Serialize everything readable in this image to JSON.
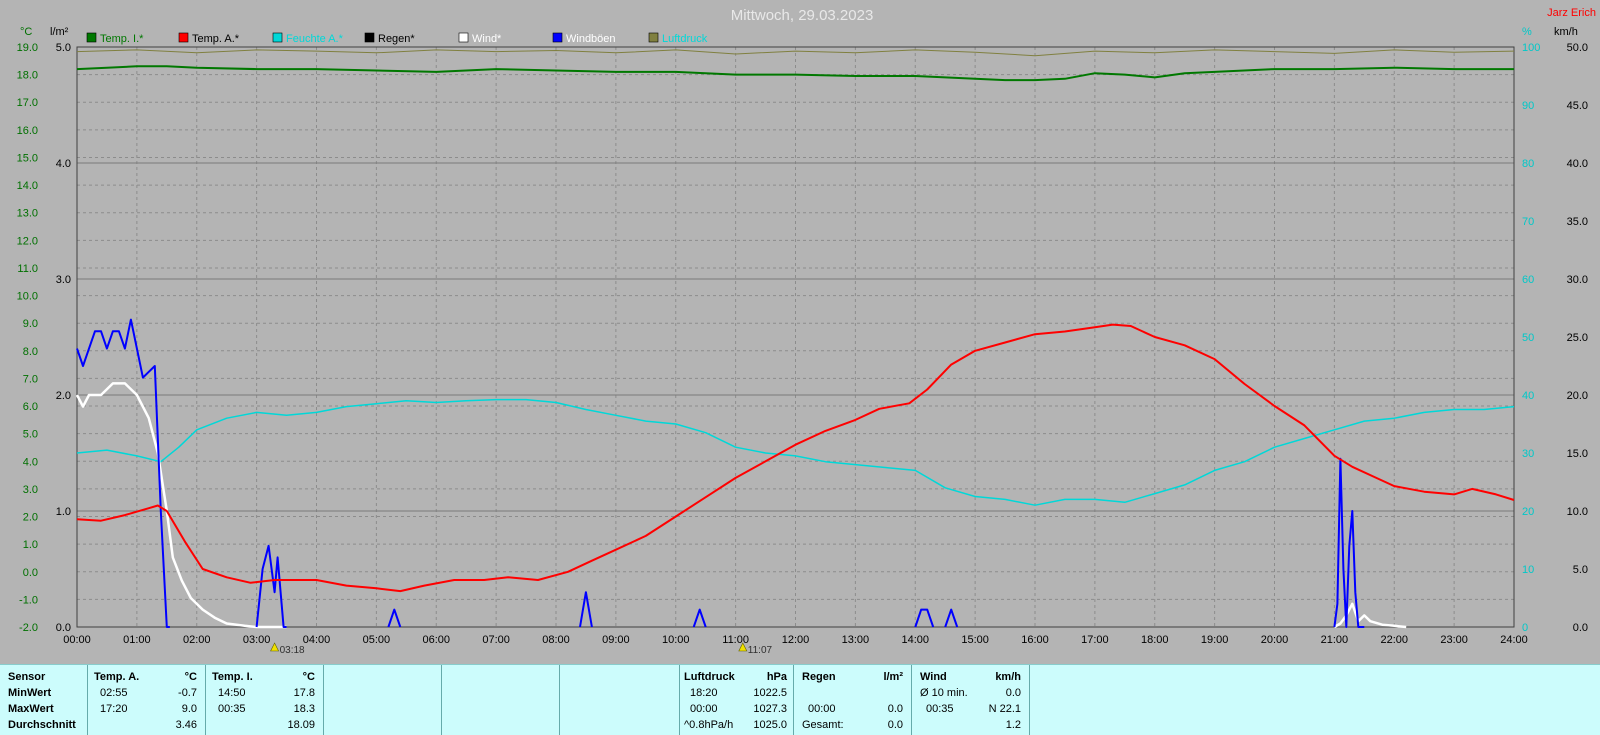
{
  "header": {
    "title": "Mittwoch, 29.03.2023",
    "author": "Jarz Erich"
  },
  "colors": {
    "temp_i": "#007800",
    "temp_a": "#ff0000",
    "feuchte": "#00d8d8",
    "regen": "#000000",
    "wind": "#ffffff",
    "windboeen": "#0000ff",
    "luftdruck": "#808040",
    "grid": "#8c8c8c",
    "axis_left_temp": "#007000",
    "axis_right_hum": "#00c8c8",
    "bg": "#b4b4b4"
  },
  "chart_data": {
    "type": "line",
    "title": "Mittwoch, 29.03.2023",
    "legend": [
      {
        "label": "Temp. I.*",
        "color": "#007800",
        "label_color": "#007800"
      },
      {
        "label": "Temp. A.*",
        "color": "#ff0000",
        "label_color": "#000000"
      },
      {
        "label": "Feuchte A.*",
        "color": "#00d8d8",
        "label_color": "#00d8d8"
      },
      {
        "label": "Regen*",
        "color": "#000000",
        "label_color": "#000000"
      },
      {
        "label": "Wind*",
        "color": "#ffffff",
        "label_color": "#ffffff"
      },
      {
        "label": "Windböen",
        "color": "#0000ff",
        "label_color": "#ffffff"
      },
      {
        "label": "Luftdruck",
        "color": "#808040",
        "label_color": "#00d8d8"
      }
    ],
    "axes": {
      "temp": {
        "unit": "°C",
        "min": -2,
        "max": 19,
        "ticks": [
          "19.0",
          "18.0",
          "17.0",
          "16.0",
          "15.0",
          "14.0",
          "13.0",
          "12.0",
          "11.0",
          "10.0",
          "9.0",
          "8.0",
          "7.0",
          "6.0",
          "5.0",
          "4.0",
          "3.0",
          "2.0",
          "1.0",
          "0.0",
          "-1.0",
          "-2.0"
        ]
      },
      "rain": {
        "unit": "l/m²",
        "min": 0,
        "max": 5,
        "ticks": [
          "5.0",
          "4.0",
          "3.0",
          "2.0",
          "1.0",
          "0.0"
        ]
      },
      "humidity": {
        "unit": "%",
        "min": 0,
        "max": 100,
        "ticks": [
          "100",
          "90",
          "80",
          "70",
          "60",
          "50",
          "40",
          "30",
          "20",
          "10",
          "0"
        ]
      },
      "wind": {
        "unit": "km/h",
        "min": 0,
        "max": 50,
        "ticks": [
          "50.0",
          "45.0",
          "40.0",
          "35.0",
          "30.0",
          "25.0",
          "20.0",
          "15.0",
          "10.0",
          "5.0",
          "0.0"
        ]
      },
      "x": {
        "min": 0,
        "max": 24,
        "ticks": [
          "00:00",
          "01:00",
          "02:00",
          "03:00",
          "04:00",
          "05:00",
          "06:00",
          "07:00",
          "08:00",
          "09:00",
          "10:00",
          "11:00",
          "12:00",
          "13:00",
          "14:00",
          "15:00",
          "16:00",
          "17:00",
          "18:00",
          "19:00",
          "20:00",
          "21:00",
          "22:00",
          "23:00",
          "24:00"
        ]
      }
    },
    "markers": [
      {
        "x": 3.3,
        "label": "03:18"
      },
      {
        "x": 11.12,
        "label": "11:07"
      }
    ],
    "series": {
      "temp_i": {
        "name": "Temp. I.*",
        "x": [
          0,
          0.5,
          1,
          1.5,
          2,
          3,
          4,
          5,
          6,
          7,
          8,
          9,
          10,
          11,
          12,
          13,
          14,
          15,
          15.5,
          16,
          16.5,
          17,
          17.5,
          18,
          18.5,
          19,
          20,
          21,
          22,
          23,
          24
        ],
        "y": [
          18.2,
          18.25,
          18.3,
          18.3,
          18.25,
          18.2,
          18.2,
          18.15,
          18.1,
          18.2,
          18.15,
          18.1,
          18.1,
          18.0,
          18.0,
          17.95,
          17.95,
          17.85,
          17.8,
          17.8,
          17.85,
          18.05,
          18.0,
          17.9,
          18.05,
          18.1,
          18.2,
          18.2,
          18.25,
          18.2,
          18.2
        ]
      },
      "temp_a": {
        "name": "Temp. A.*",
        "x": [
          0,
          0.4,
          0.8,
          1.2,
          1.35,
          1.5,
          1.8,
          2.1,
          2.5,
          2.9,
          3.3,
          4.0,
          4.5,
          5.0,
          5.4,
          5.8,
          6.3,
          6.8,
          7.2,
          7.7,
          8.2,
          8.6,
          9.0,
          9.5,
          10.0,
          10.5,
          11.0,
          11.5,
          12.0,
          12.5,
          13.0,
          13.4,
          13.9,
          14.2,
          14.6,
          15.0,
          15.5,
          16.0,
          16.5,
          17.0,
          17.3,
          17.6,
          18.0,
          18.5,
          19.0,
          19.5,
          20.0,
          20.5,
          21.0,
          21.3,
          21.7,
          22.0,
          22.5,
          23.0,
          23.3,
          23.7,
          24.0
        ],
        "y": [
          1.9,
          1.85,
          2.05,
          2.3,
          2.4,
          2.2,
          1.1,
          0.1,
          -0.2,
          -0.4,
          -0.3,
          -0.3,
          -0.5,
          -0.6,
          -0.7,
          -0.5,
          -0.3,
          -0.3,
          -0.2,
          -0.3,
          0.0,
          0.4,
          0.8,
          1.3,
          2.0,
          2.7,
          3.4,
          4.0,
          4.6,
          5.1,
          5.5,
          5.9,
          6.1,
          6.6,
          7.5,
          8.0,
          8.3,
          8.6,
          8.7,
          8.85,
          8.95,
          8.9,
          8.5,
          8.2,
          7.7,
          6.8,
          6.0,
          5.3,
          4.2,
          3.8,
          3.4,
          3.1,
          2.9,
          2.8,
          3.0,
          2.8,
          2.6
        ]
      },
      "feuchte": {
        "name": "Feuchte A.*",
        "x": [
          0,
          0.5,
          1.0,
          1.4,
          1.7,
          2.0,
          2.5,
          3.0,
          3.5,
          4.0,
          4.5,
          5.0,
          5.5,
          6.0,
          6.5,
          7.0,
          7.5,
          8.0,
          8.5,
          9.0,
          9.5,
          10.0,
          10.5,
          11.0,
          11.5,
          12.0,
          12.5,
          13.0,
          13.5,
          14.0,
          14.5,
          15.0,
          15.5,
          16.0,
          16.5,
          17.0,
          17.5,
          18.0,
          18.5,
          19.0,
          19.5,
          20.0,
          20.5,
          21.0,
          21.5,
          22.0,
          22.5,
          23.0,
          23.5,
          24.0
        ],
        "y": [
          30,
          30.5,
          29.5,
          28.5,
          31,
          34,
          36,
          37,
          36.5,
          37,
          38,
          38.5,
          39,
          38.7,
          39,
          39.2,
          39.2,
          38.7,
          37.5,
          36.5,
          35.5,
          35,
          33.5,
          31,
          30,
          29.5,
          28.5,
          28,
          27.5,
          27,
          24,
          22.5,
          22,
          21,
          22,
          22,
          21.5,
          23,
          24.5,
          27,
          28.5,
          31,
          32.5,
          34,
          35.5,
          36,
          37,
          37.5,
          37.5,
          38
        ]
      },
      "wind": {
        "name": "Wind*",
        "x": [
          0,
          0.1,
          0.2,
          0.4,
          0.6,
          0.8,
          1.0,
          1.2,
          1.35,
          1.5,
          1.6,
          1.75,
          1.9,
          2.1,
          2.3,
          2.5,
          2.8,
          3.0,
          3.2,
          3.5,
          21.0,
          21.1,
          21.2,
          21.3,
          21.4,
          21.5,
          21.6,
          21.8,
          22.0,
          22.2
        ],
        "y": [
          20,
          19,
          20,
          20,
          21,
          21,
          20,
          18,
          15,
          10,
          6,
          4,
          2.5,
          1.5,
          0.8,
          0.3,
          0.1,
          0,
          0,
          0,
          0,
          0.3,
          1,
          2,
          0.5,
          1,
          0.5,
          0.2,
          0.1,
          0
        ],
        "segments": [
          [
            0,
            19
          ],
          [
            20,
            29
          ]
        ]
      },
      "windboeen": {
        "name": "Windböen",
        "x": [
          0,
          0.1,
          0.2,
          0.3,
          0.4,
          0.5,
          0.6,
          0.7,
          0.8,
          0.9,
          1.0,
          1.1,
          1.2,
          1.3,
          1.4,
          1.5,
          1.55,
          3.0,
          3.1,
          3.2,
          3.3,
          3.35,
          3.45,
          3.5,
          5.2,
          5.3,
          5.4,
          8.4,
          8.5,
          8.6,
          10.3,
          10.4,
          10.5,
          14.0,
          14.1,
          14.2,
          14.3,
          14.5,
          14.6,
          14.7,
          21.0,
          21.05,
          21.1,
          21.15,
          21.2,
          21.25,
          21.3,
          21.35,
          21.4,
          21.45,
          21.5
        ],
        "y": [
          24,
          22.5,
          24,
          25.5,
          25.5,
          24,
          25.5,
          25.5,
          24,
          26.5,
          24,
          21.5,
          22,
          22.5,
          10,
          0,
          0,
          0,
          5,
          7,
          3,
          6,
          0,
          0,
          0,
          1.5,
          0,
          0,
          3,
          0,
          0,
          1.5,
          0,
          0,
          1.5,
          1.5,
          0,
          0,
          1.5,
          0,
          0,
          2,
          14.5,
          5,
          0,
          7,
          10,
          3,
          0,
          0,
          0
        ],
        "segments": [
          [
            0,
            16
          ],
          [
            17,
            23
          ],
          [
            24,
            26
          ],
          [
            27,
            29
          ],
          [
            30,
            32
          ],
          [
            33,
            36
          ],
          [
            37,
            39
          ],
          [
            40,
            50
          ]
        ]
      },
      "luftdruck": {
        "name": "Luftdruck",
        "x": [
          0,
          1,
          2,
          3,
          4,
          5,
          6,
          7,
          8,
          9,
          10,
          11,
          12,
          13,
          14,
          15,
          16,
          17,
          18,
          19,
          20,
          21,
          22,
          23,
          24
        ],
        "y": [
          99.2,
          99.5,
          99.0,
          99.5,
          99.3,
          99.0,
          99.5,
          99.2,
          99.4,
          99.0,
          99.5,
          98.8,
          99.3,
          99.0,
          99.5,
          99.1,
          98.5,
          99.3,
          99.0,
          99.5,
          99.2,
          98.9,
          99.5,
          99.1,
          99.3
        ]
      }
    }
  },
  "stats": {
    "sensor": {
      "h1": "Sensor",
      "r1": "MinWert",
      "r2": "MaxWert",
      "r3": "Durchschnitt"
    },
    "temp_a": {
      "h": "Temp. A.",
      "u": "°C",
      "min_t": "02:55",
      "min_v": "-0.7",
      "max_t": "17:20",
      "max_v": "9.0",
      "avg_v": "3.46"
    },
    "temp_i": {
      "h": "Temp. I.",
      "u": "°C",
      "min_t": "14:50",
      "min_v": "17.8",
      "max_t": "00:35",
      "max_v": "18.3",
      "avg_v": "18.09"
    },
    "druck": {
      "h": "Luftdruck",
      "u": "hPa",
      "min_t": "18:20",
      "min_v": "1022.5",
      "max_t": "00:00",
      "max_v": "1027.3",
      "avg_t": "^0.8hPa/h",
      "avg_v": "1025.0"
    },
    "regen": {
      "h": "Regen",
      "u": "l/m²",
      "max_t": "00:00",
      "max_v": "0.0",
      "avg_t": "Gesamt:",
      "avg_v": "0.0"
    },
    "wind": {
      "h": "Wind",
      "u": "km/h",
      "min_t": "Ø 10 min.",
      "min_v": "0.0",
      "max_t": "00:35",
      "max_v": "N 22.1",
      "avg_v": "1.2"
    }
  }
}
